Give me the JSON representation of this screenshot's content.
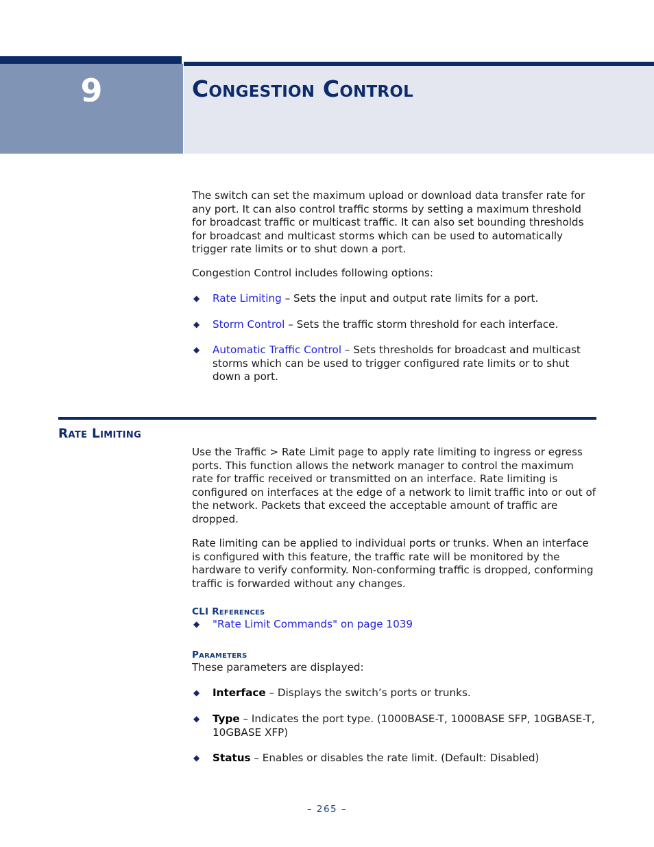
{
  "chapter": {
    "number": "9",
    "title": "Congestion Control"
  },
  "intro": {
    "paragraph_1": "The switch can set the maximum upload or download data transfer rate for any port. It can also control traffic storms by setting a maximum threshold for broadcast traffic or multicast traffic. It can also set bounding thresholds for broadcast and multicast storms which can be used to automatically trigger rate limits or to shut down a port.",
    "paragraph_2": "Congestion Control includes following options:",
    "options": [
      {
        "bullet": "◆",
        "link": "Rate Limiting",
        "description": " – Sets the input and output rate limits for a port."
      },
      {
        "bullet": "◆",
        "link": "Storm Control",
        "description": " – Sets the traffic storm threshold for each interface."
      },
      {
        "bullet": "◆",
        "link": "Automatic Traffic Control",
        "description": " – Sets thresholds for broadcast and multicast storms which can be used to trigger configured rate limits or to shut down a port."
      }
    ]
  },
  "section": {
    "heading": "Rate Limiting",
    "paragraph_1": "Use the Traffic > Rate Limit page to apply rate limiting to ingress or egress ports. This function allows the network manager to control the maximum rate for traffic received or transmitted on an interface. Rate limiting is configured on interfaces at the edge of a network to limit traffic into or out of the network. Packets that exceed the acceptable amount of traffic are dropped.",
    "paragraph_2": "Rate limiting can be applied to individual ports or trunks. When an interface is configured with this feature, the traffic rate will be monitored by the hardware to verify conformity. Non-conforming traffic is dropped, conforming traffic is forwarded without any changes.",
    "cli_references": {
      "heading": "CLI References",
      "items": [
        {
          "bullet": "◆",
          "link": "\"Rate Limit Commands\" on page 1039"
        }
      ]
    },
    "parameters": {
      "heading": "Parameters",
      "intro": "These parameters are displayed:",
      "items": [
        {
          "bullet": "◆",
          "term": "Interface",
          "description": " – Displays the switch’s ports or trunks."
        },
        {
          "bullet": "◆",
          "term": "Type",
          "description": " – Indicates the port type. (1000BASE-T, 1000BASE SFP, 10GBASE-T, 10GBASE XFP)"
        },
        {
          "bullet": "◆",
          "term": "Status",
          "description": " – Enables or disables the rate limit. (Default: Disabled)"
        }
      ]
    }
  },
  "footer": {
    "page_number": "–  265  –"
  },
  "colors": {
    "navy": "#0a2b66",
    "title_navy": "#0d2a6b",
    "chapter_box": "#8094b5",
    "header_band": "#e4e7f0",
    "link_blue": "#2222dd",
    "bullet_navy": "#17256e",
    "footer_navy": "#20457d"
  }
}
